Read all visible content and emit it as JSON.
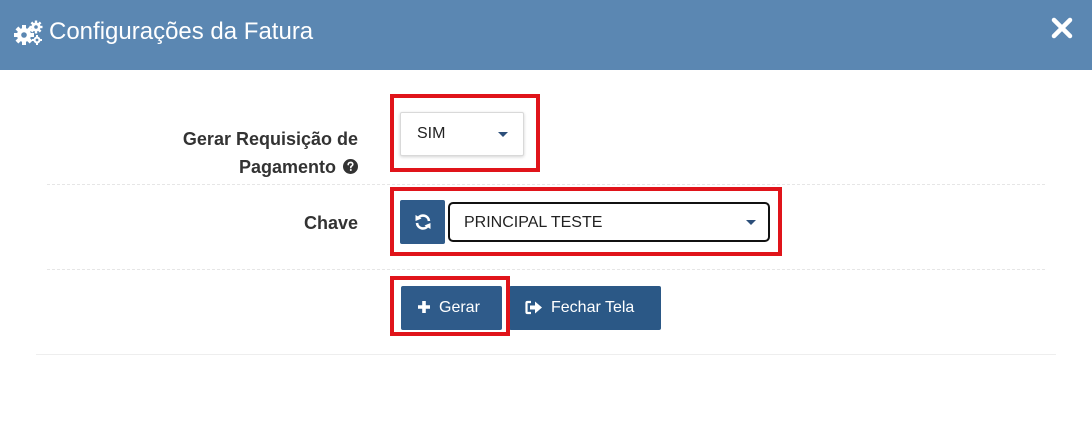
{
  "modal": {
    "title": "Configurações da Fatura",
    "header_icon": "cogs-icon",
    "close_icon": "close-icon"
  },
  "form": {
    "gerar_requisicao": {
      "label_line1": "Gerar Requisição de",
      "label_line2": "Pagamento",
      "help_icon": "question-circle-icon",
      "selected_value": "SIM"
    },
    "chave": {
      "label": "Chave",
      "refresh_icon": "refresh-icon",
      "selected_value": "PRINCIPAL TESTE"
    }
  },
  "actions": {
    "gerar_label": "Gerar",
    "gerar_icon": "plus-icon",
    "fechar_label": "Fechar Tela",
    "fechar_icon": "sign-out-icon"
  },
  "colors": {
    "header_bg": "#5b87b2",
    "button_bg": "#2f5b8a",
    "highlight": "#e0141a"
  }
}
